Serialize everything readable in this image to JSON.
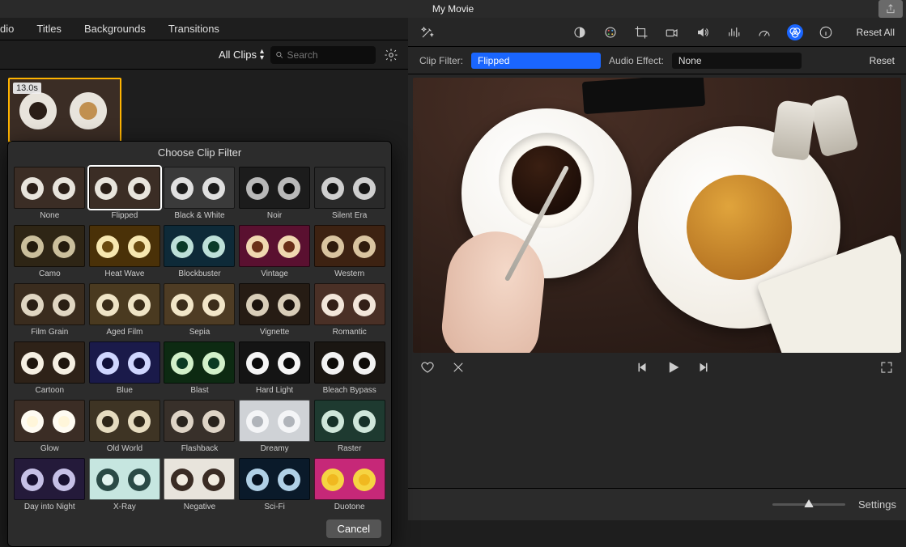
{
  "title": "My Movie",
  "tabs": [
    "dio",
    "Titles",
    "Backgrounds",
    "Transitions"
  ],
  "browser": {
    "all_clips": "All Clips",
    "search_placeholder": "Search"
  },
  "clip": {
    "duration": "13.0s"
  },
  "filter_picker": {
    "title": "Choose Clip Filter",
    "selected": "Flipped",
    "cancel": "Cancel",
    "filters": [
      {
        "name": "None",
        "bg": "#3b2d25",
        "plate": "#e8e4dc",
        "cup": "#2a1e17"
      },
      {
        "name": "Flipped",
        "bg": "#3b2d25",
        "plate": "#e8e4dc",
        "cup": "#2a1e17"
      },
      {
        "name": "Black & White",
        "bg": "#3a3a3a",
        "plate": "#e0e0e0",
        "cup": "#1c1c1c"
      },
      {
        "name": "Noir",
        "bg": "#1c1c1c",
        "plate": "#b8b8b8",
        "cup": "#0c0c0c"
      },
      {
        "name": "Silent Era",
        "bg": "#2a2a2a",
        "plate": "#cfcfcf",
        "cup": "#151515"
      },
      {
        "name": "Camo",
        "bg": "#2e2515",
        "plate": "#cbbf9c",
        "cup": "#241b0d"
      },
      {
        "name": "Heat Wave",
        "bg": "#4a3108",
        "plate": "#f7e7b0",
        "cup": "#6a4a10"
      },
      {
        "name": "Blockbuster",
        "bg": "#0e2a38",
        "plate": "#bde0d8",
        "cup": "#0a3a28"
      },
      {
        "name": "Vintage",
        "bg": "#5a1030",
        "plate": "#f0d8b0",
        "cup": "#6a3018"
      },
      {
        "name": "Western",
        "bg": "#3d2212",
        "plate": "#d9c4a0",
        "cup": "#2e1a0c"
      },
      {
        "name": "Film Grain",
        "bg": "#3a2c1e",
        "plate": "#e0d6c2",
        "cup": "#2a1f14"
      },
      {
        "name": "Aged Film",
        "bg": "#4a3a20",
        "plate": "#efe4c6",
        "cup": "#3a2c18"
      },
      {
        "name": "Sepia",
        "bg": "#4e3c24",
        "plate": "#f2e6c8",
        "cup": "#3c2d1a"
      },
      {
        "name": "Vignette",
        "bg": "#261c14",
        "plate": "#d8cdb8",
        "cup": "#1a120c"
      },
      {
        "name": "Romantic",
        "bg": "#4a3026",
        "plate": "#f2e6da",
        "cup": "#321f17"
      },
      {
        "name": "Cartoon",
        "bg": "#2e2218",
        "plate": "#f5efe2",
        "cup": "#1e150d"
      },
      {
        "name": "Blue",
        "bg": "#1a1a4a",
        "plate": "#cfd6ff",
        "cup": "#10103a"
      },
      {
        "name": "Blast",
        "bg": "#0d2a12",
        "plate": "#d2f0c9",
        "cup": "#0a3a22"
      },
      {
        "name": "Hard Light",
        "bg": "#141414",
        "plate": "#f5f5f5",
        "cup": "#0a0a0a"
      },
      {
        "name": "Bleach Bypass",
        "bg": "#1a1612",
        "plate": "#f2f2f2",
        "cup": "#0e0b08"
      },
      {
        "name": "Glow",
        "bg": "#3b2d25",
        "plate": "#fefbf2",
        "cup": "#fff6da"
      },
      {
        "name": "Old World",
        "bg": "#3e3424",
        "plate": "#e6dcc0",
        "cup": "#2e2618"
      },
      {
        "name": "Flashback",
        "bg": "#38302a",
        "plate": "#ded4c6",
        "cup": "#28221c"
      },
      {
        "name": "Dreamy",
        "bg": "#cfd2d6",
        "plate": "#f4f5f7",
        "cup": "#b0b4ba"
      },
      {
        "name": "Raster",
        "bg": "#1e3a30",
        "plate": "#cfe6da",
        "cup": "#163028"
      },
      {
        "name": "Day into Night",
        "bg": "#241a3a",
        "plate": "#c6c0e6",
        "cup": "#181030"
      },
      {
        "name": "X-Ray",
        "bg": "#c6e6e0",
        "plate": "#2a4a46",
        "cup": "#e2f4f0"
      },
      {
        "name": "Negative",
        "bg": "#e8e4dc",
        "plate": "#3a2c24",
        "cup": "#f2ece0"
      },
      {
        "name": "Sci-Fi",
        "bg": "#0a1a2a",
        "plate": "#b0d0e6",
        "cup": "#061220"
      },
      {
        "name": "Duotone",
        "bg": "#c62878",
        "plate": "#f6d442",
        "cup": "#f0b820"
      }
    ]
  },
  "adjust": {
    "clip_filter_label": "Clip Filter:",
    "clip_filter_value": "Flipped",
    "audio_effect_label": "Audio Effect:",
    "audio_effect_value": "None",
    "reset_all": "Reset All",
    "reset": "Reset"
  },
  "bottom": {
    "settings": "Settings"
  },
  "colors": {
    "accent": "#1a66ff",
    "clip_select": "#ffb400"
  }
}
